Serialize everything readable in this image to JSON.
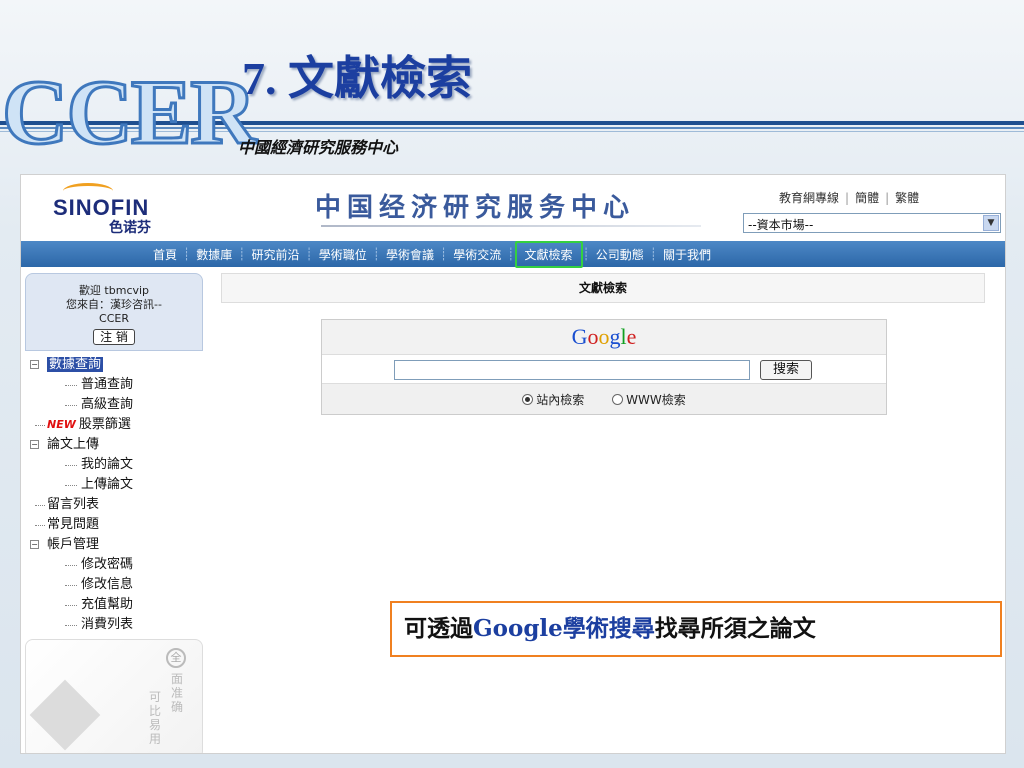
{
  "slide": {
    "logo_text": "CCER",
    "title": "7. 文獻檢索",
    "subtitle": "中國經濟研究服務中心"
  },
  "header": {
    "brand_main": "SINOFIN",
    "brand_sub": "色诺芬",
    "site_name": "中国经济研究服务中心",
    "toplinks": [
      "教育網專線",
      "簡體",
      "繁體"
    ],
    "market_select_value": "--資本市場--"
  },
  "nav": {
    "items": [
      {
        "label": "首頁"
      },
      {
        "label": "數據庫"
      },
      {
        "label": "研究前沿"
      },
      {
        "label": "學術職位"
      },
      {
        "label": "學術會議"
      },
      {
        "label": "學術交流"
      },
      {
        "label": "文獻檢索",
        "active": true
      },
      {
        "label": "公司動態"
      },
      {
        "label": "關于我們"
      }
    ]
  },
  "sidebar": {
    "welcome_line1": "歡迎 tbmcvip",
    "welcome_line2": "您來自：漢珍咨訊--",
    "welcome_line3": "CCER",
    "logout_label": "注 销",
    "tree": [
      {
        "label": "數據查詢",
        "level": 0,
        "toggle": "−",
        "highlight": true
      },
      {
        "label": "普通查詢",
        "level": 1
      },
      {
        "label": "高級查詢",
        "level": 1
      },
      {
        "label": "股票篩選",
        "level": 0,
        "badge": "NEW"
      },
      {
        "label": "論文上傳",
        "level": 0,
        "toggle": "−"
      },
      {
        "label": "我的論文",
        "level": 1
      },
      {
        "label": "上傳論文",
        "level": 1
      },
      {
        "label": "留言列表",
        "level": 0
      },
      {
        "label": "常見問題",
        "level": 0
      },
      {
        "label": "帳戶管理",
        "level": 0,
        "toggle": "−"
      },
      {
        "label": "修改密碼",
        "level": 1
      },
      {
        "label": "修改信息",
        "level": 1
      },
      {
        "label": "充值幫助",
        "level": 1
      },
      {
        "label": "消費列表",
        "level": 1
      }
    ],
    "ad_circle": "全",
    "ad_col1": "面准确",
    "ad_col2": "可比易用"
  },
  "search": {
    "panel_title": "文獻檢索",
    "logo": [
      "G",
      "o",
      "o",
      "g",
      "l",
      "e"
    ],
    "input_value": "",
    "button_label": "搜索",
    "options": [
      {
        "label": "站內檢索",
        "checked": true
      },
      {
        "label": "WWW檢索",
        "checked": false
      }
    ]
  },
  "callout": {
    "part1": "可透過",
    "part2": "Google學術搜尋",
    "part3": "找尋所須之論文"
  }
}
